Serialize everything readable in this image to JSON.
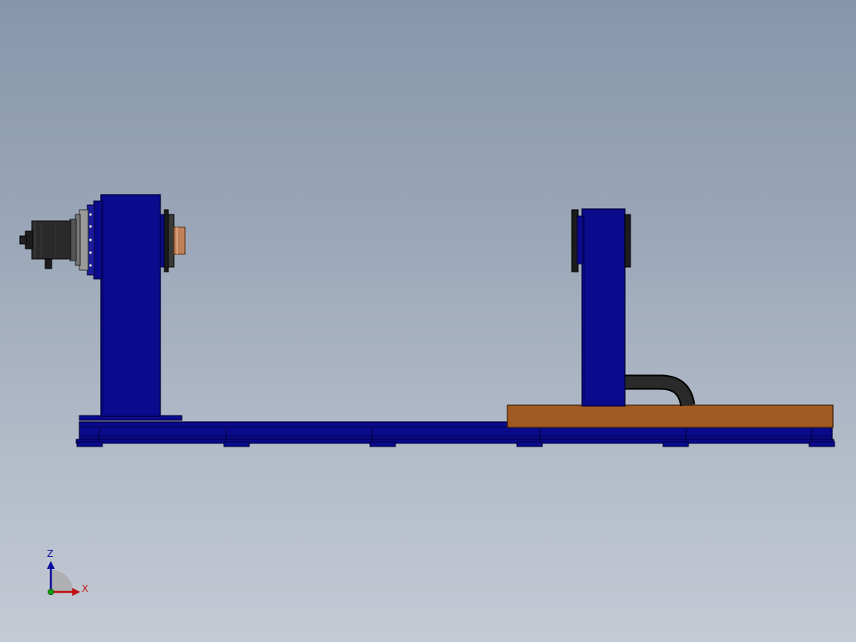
{
  "viewport": {
    "background_top": "#8796ab",
    "background_bottom": "#c4cad4"
  },
  "colors": {
    "frame_blue": "#0a0a8c",
    "frame_edge": "#000033",
    "plate_brown": "#a05a22",
    "hose_black": "#1c1c1c",
    "copper": "#c08058",
    "motor_grey": "#2a2a2a"
  },
  "model": {
    "parts": [
      "base-rail",
      "headstock-column",
      "servo-motor",
      "gearbox",
      "faceplate",
      "tailstock-column",
      "tailstock-chuck",
      "slide-plate",
      "cable-hose",
      "foot-pad"
    ]
  },
  "triad": {
    "z_label": "Z",
    "x_label": "X",
    "z_color": "#0b0b9e",
    "x_color": "#c01010",
    "origin_color": "#10a010"
  }
}
